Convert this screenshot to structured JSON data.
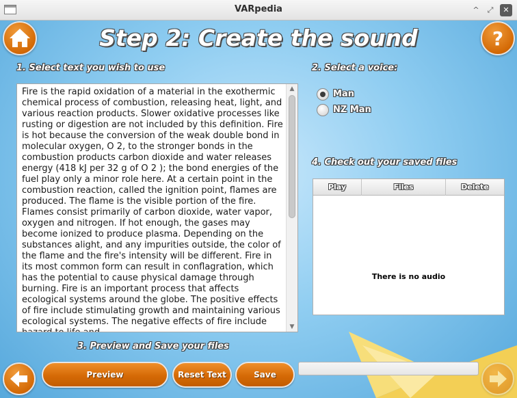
{
  "window": {
    "title": "VARpedia"
  },
  "header": {
    "title": "Step 2: Create the sound"
  },
  "steps": {
    "select_text": "1. Select text you wish to use",
    "select_voice": "2. Select a voice:",
    "preview_save": "3. Preview and Save your files",
    "saved_files": "4. Check out your saved files"
  },
  "text_body": "Fire is the rapid oxidation of a material in the exothermic chemical process of combustion, releasing heat, light, and various reaction products. Slower oxidative processes like rusting or digestion are not included by this definition. Fire is hot because the conversion of the weak double bond in molecular oxygen, O 2, to the stronger bonds in the combustion products carbon dioxide and water releases energy (418 kJ per 32 g of O 2 ); the bond energies of the fuel play only a minor role here. At a certain point in the combustion reaction, called the ignition point, flames are produced. The flame is the visible portion of the fire. Flames consist primarily of carbon dioxide, water vapor, oxygen and nitrogen. If hot enough, the gases may become ionized to produce plasma. Depending on the substances alight, and any impurities outside, the color of the flame and the fire's intensity will be different. Fire in its most common form can result in conflagration, which has the potential to cause physical damage through burning. Fire is an important process that affects ecological systems around the globe. The positive effects of fire include stimulating growth and maintaining various ecological systems. The negative effects of fire include hazard to life and",
  "voices": [
    {
      "label": "Man",
      "selected": true
    },
    {
      "label": "NZ Man",
      "selected": false
    }
  ],
  "files_table": {
    "columns": [
      "Play",
      "Files",
      "Delete"
    ],
    "empty_message": "There is no audio"
  },
  "buttons": {
    "preview": "Preview",
    "reset_text": "Reset Text",
    "save": "Save"
  },
  "progress": {
    "value": 0
  },
  "icons": {
    "home": "home-icon",
    "help": "question-mark-icon",
    "back": "arrow-left-icon",
    "next": "arrow-right-icon"
  },
  "colors": {
    "accent": "#d56a06",
    "background": "#8fcdf1"
  }
}
